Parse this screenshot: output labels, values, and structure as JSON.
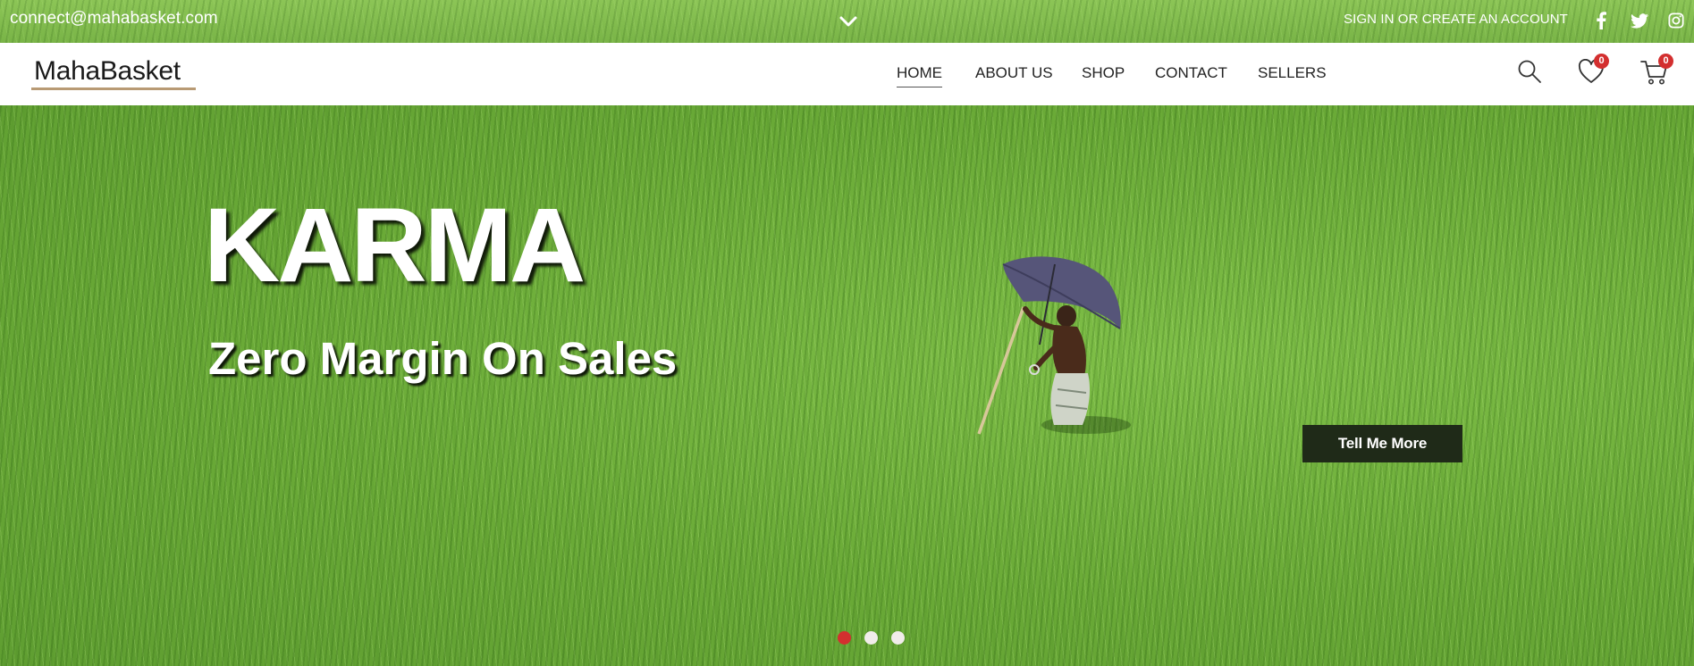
{
  "topbar": {
    "email": "connect@mahabasket.com",
    "signin_label": "SIGN IN OR CREATE AN ACCOUNT",
    "toggle_icon": "chevron-down-icon",
    "social": [
      "facebook-icon",
      "twitter-icon",
      "instagram-icon"
    ]
  },
  "header": {
    "logo_text": "MahaBasket",
    "nav": {
      "home": "HOME",
      "about": "ABOUT US",
      "shop": "SHOP",
      "contact": "CONTACT",
      "sellers": "SELLERS"
    },
    "wishlist_count": "0",
    "cart_count": "0"
  },
  "hero": {
    "title": "KARMA",
    "subtitle": "Zero Margin On Sales",
    "cta_label": "Tell Me More",
    "slides": 3,
    "active_slide": 1
  },
  "colors": {
    "accent": "#d32f2f",
    "logo_underline": "#b89a74",
    "cta_bg": "#1f2a18"
  }
}
